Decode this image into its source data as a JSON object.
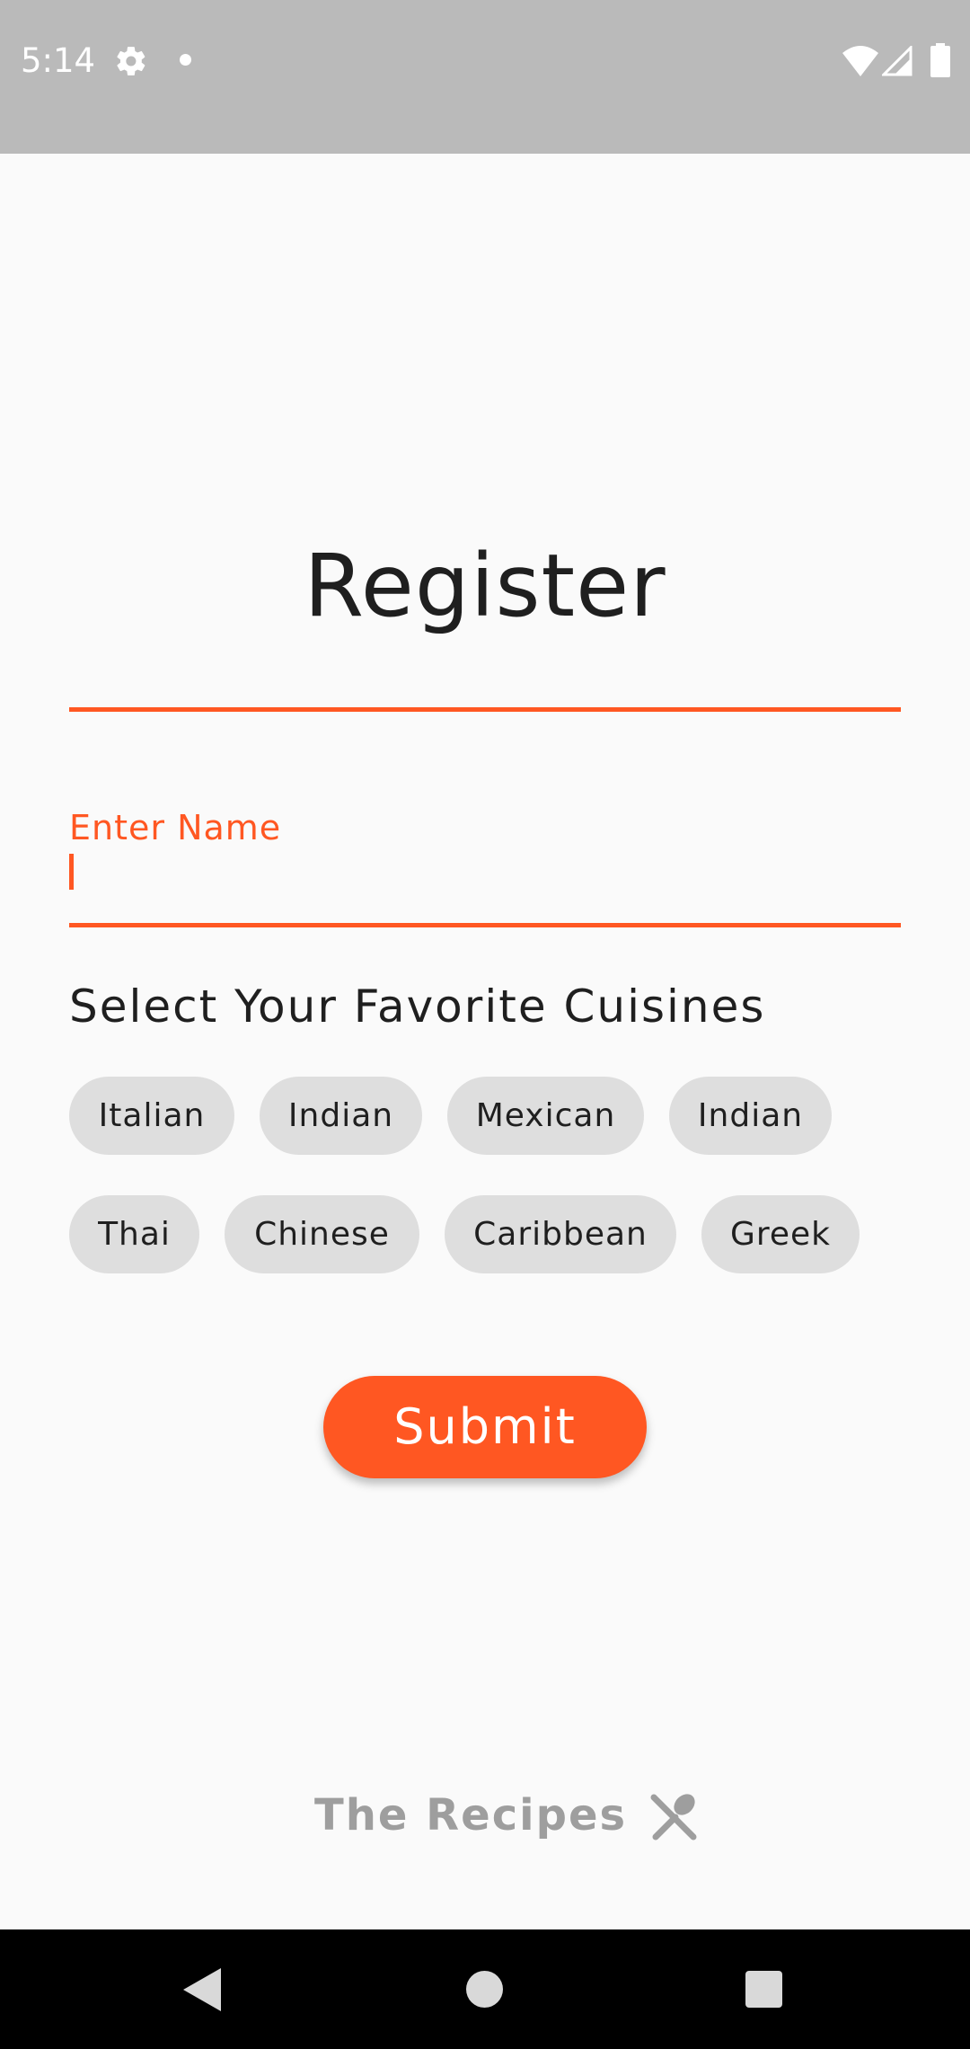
{
  "status_bar": {
    "time": "5:14",
    "icons": [
      "gear-icon",
      "notification-dot-icon",
      "wifi-icon",
      "cell-signal-icon",
      "battery-icon"
    ]
  },
  "page": {
    "title": "Register"
  },
  "form": {
    "name_label": "Enter Name",
    "name_value": "",
    "cuisines_heading": "Select Your Favorite Cuisines",
    "cuisines": [
      "Italian",
      "Indian",
      "Mexican",
      "Indian",
      "Thai",
      "Chinese",
      "Caribbean",
      "Greek"
    ],
    "submit_label": "Submit"
  },
  "footer": {
    "brand": "The Recipes",
    "brand_icon": "fork-spoon-icon"
  },
  "nav_bar": {
    "icons": [
      "back-icon",
      "home-icon",
      "recents-icon"
    ]
  },
  "colors": {
    "accent": "#ff5722",
    "chip_background": "#dedede",
    "status_bar_background": "#bababa",
    "page_background": "#fafafa",
    "muted_text": "#9e9e9e"
  }
}
